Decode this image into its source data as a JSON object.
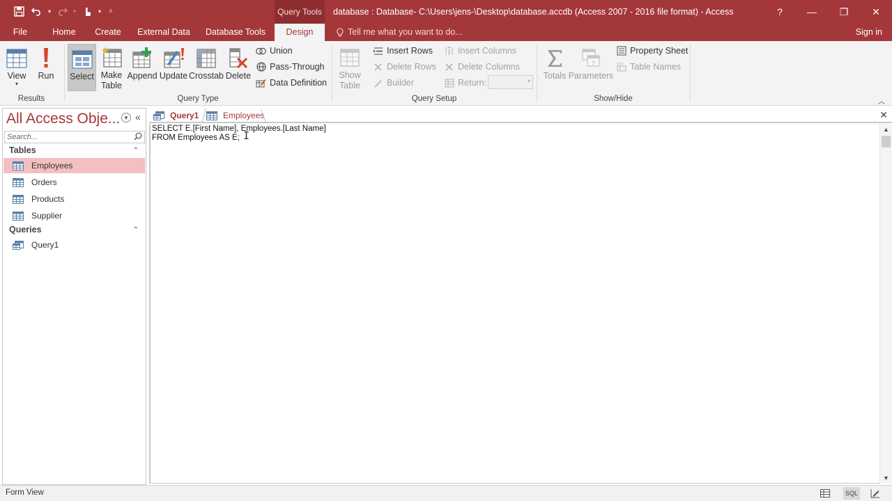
{
  "titlebar": {
    "context_group": "Query Tools",
    "window_title": "database : Database- C:\\Users\\jens-\\Desktop\\database.accdb (Access 2007 - 2016 file format) - Access",
    "help_label": "?",
    "minimize_label": "—",
    "restore_label": "❐",
    "close_label": "✕"
  },
  "tabs": {
    "file": "File",
    "home": "Home",
    "create": "Create",
    "external_data": "External Data",
    "database_tools": "Database Tools",
    "design": "Design",
    "tell_me": "Tell me what you want to do...",
    "sign_in": "Sign in"
  },
  "ribbon": {
    "results": {
      "group_label": "Results",
      "view_label": "View",
      "run_label": "Run"
    },
    "query_type": {
      "group_label": "Query Type",
      "select_label": "Select",
      "make_table_label": "Make\nTable",
      "append_label": "Append",
      "update_label": "Update",
      "crosstab_label": "Crosstab",
      "delete_label": "Delete",
      "union_label": "Union",
      "pass_through_label": "Pass-Through",
      "data_definition_label": "Data Definition"
    },
    "query_setup": {
      "group_label": "Query Setup",
      "show_table_label": "Show\nTable",
      "insert_rows_label": "Insert Rows",
      "delete_rows_label": "Delete Rows",
      "builder_label": "Builder",
      "insert_columns_label": "Insert Columns",
      "delete_columns_label": "Delete Columns",
      "return_label": "Return:",
      "return_value": ""
    },
    "show_hide": {
      "group_label": "Show/Hide",
      "totals_label": "Totals",
      "parameters_label": "Parameters",
      "property_sheet_label": "Property Sheet",
      "table_names_label": "Table Names"
    }
  },
  "nav": {
    "title": "All Access Obje...",
    "search_placeholder": "Search...",
    "tables_header": "Tables",
    "queries_header": "Queries",
    "tables": [
      "Employees",
      "Orders",
      "Products",
      "Supplier"
    ],
    "queries": [
      "Query1"
    ]
  },
  "doc_tabs": {
    "query1": "Query1",
    "employees": "Employees"
  },
  "sql": {
    "line1": "SELECT E.[First Name], Employees.[Last Name]",
    "line2": "FROM Employees AS E;"
  },
  "statusbar": {
    "text": "Form View",
    "sql_view_label": "SQL"
  },
  "colors": {
    "accent": "#a4373a",
    "selection": "#f4bfc0"
  }
}
